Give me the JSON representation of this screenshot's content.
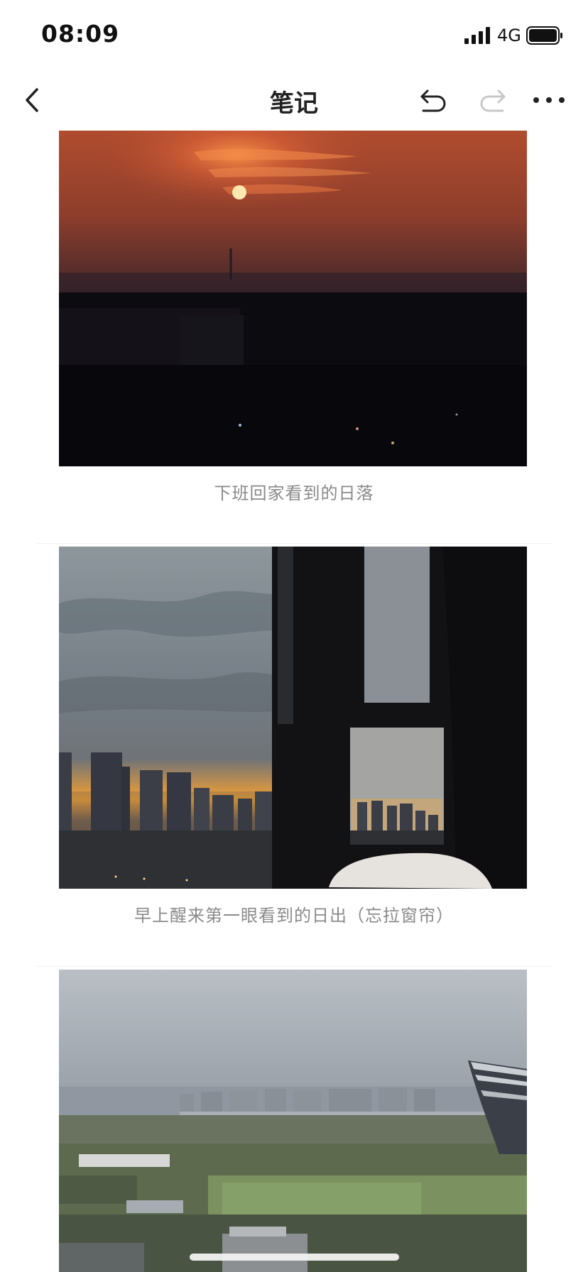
{
  "status_bar": {
    "time": "08:09",
    "network": "4G"
  },
  "nav": {
    "title": "笔记"
  },
  "note_items": [
    {
      "caption": "下班回家看到的日落",
      "image_alt": "sunset over dark city skyline"
    },
    {
      "caption": "早上醒来第一眼看到的日出（忘拉窗帘）",
      "image_alt": "sunrise skyline seen through window frame"
    },
    {
      "caption": "",
      "image_alt": "overcast morning view of city and park"
    }
  ]
}
